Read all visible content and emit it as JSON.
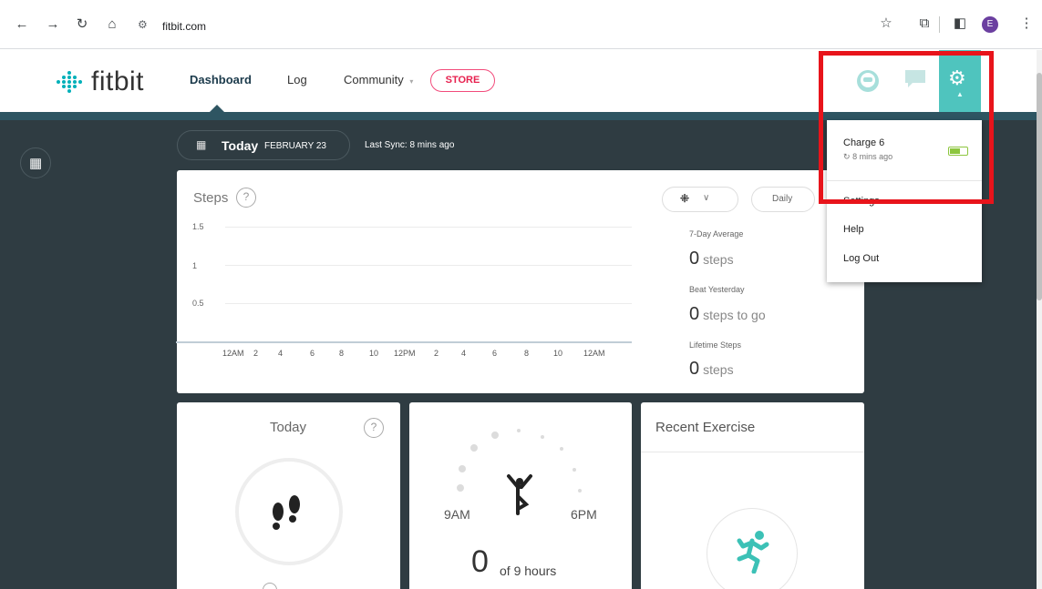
{
  "browser": {
    "url": "fitbit.com",
    "profile_initial": "E",
    "icons": [
      "back-icon",
      "forward-icon",
      "reload-icon",
      "home-icon",
      "site-settings-icon",
      "bookmark-star-icon",
      "extensions-icon",
      "side-panel-icon",
      "menu-icon"
    ]
  },
  "header": {
    "logo_text": "fitbit",
    "nav": {
      "dashboard": "Dashboard",
      "log": "Log",
      "community": "Community",
      "store": "STORE"
    },
    "accent": "#00b0b9",
    "store_color": "#e7214f",
    "gear_tab_color": "#4fc4be"
  },
  "toolbar": {
    "today": "Today",
    "date": "FEBRUARY 23",
    "last_sync": "Last Sync: 8 mins ago"
  },
  "steps_card": {
    "title": "Steps",
    "help": "?",
    "view_select": "Daily",
    "stats": [
      {
        "label": "7-Day Average",
        "value": "0",
        "unit": "steps"
      },
      {
        "label": "Beat Yesterday",
        "value": "0",
        "unit": "steps to go"
      },
      {
        "label": "Lifetime Steps",
        "value": "0",
        "unit": "steps"
      }
    ]
  },
  "chart_data": {
    "type": "bar",
    "categories": [
      "12AM",
      "2",
      "4",
      "6",
      "8",
      "10",
      "12PM",
      "2",
      "4",
      "6",
      "8",
      "10",
      "12AM"
    ],
    "values": [
      0,
      0,
      0,
      0,
      0,
      0,
      0,
      0,
      0,
      0,
      0,
      0,
      0
    ],
    "yticks": [
      "1.5",
      "1",
      "0.5"
    ],
    "title": "Steps",
    "grid": true
  },
  "today_card": {
    "title": "Today",
    "help": "?"
  },
  "hourly_card": {
    "start": "9AM",
    "end": "6PM",
    "value": "0",
    "of_text": "of 9 hours"
  },
  "exercise_card": {
    "title": "Recent Exercise"
  },
  "dropdown": {
    "device_name": "Charge 6",
    "device_sync": "8 mins ago",
    "battery_level": 0.6,
    "items": [
      "Settings",
      "Help",
      "Log Out"
    ]
  }
}
